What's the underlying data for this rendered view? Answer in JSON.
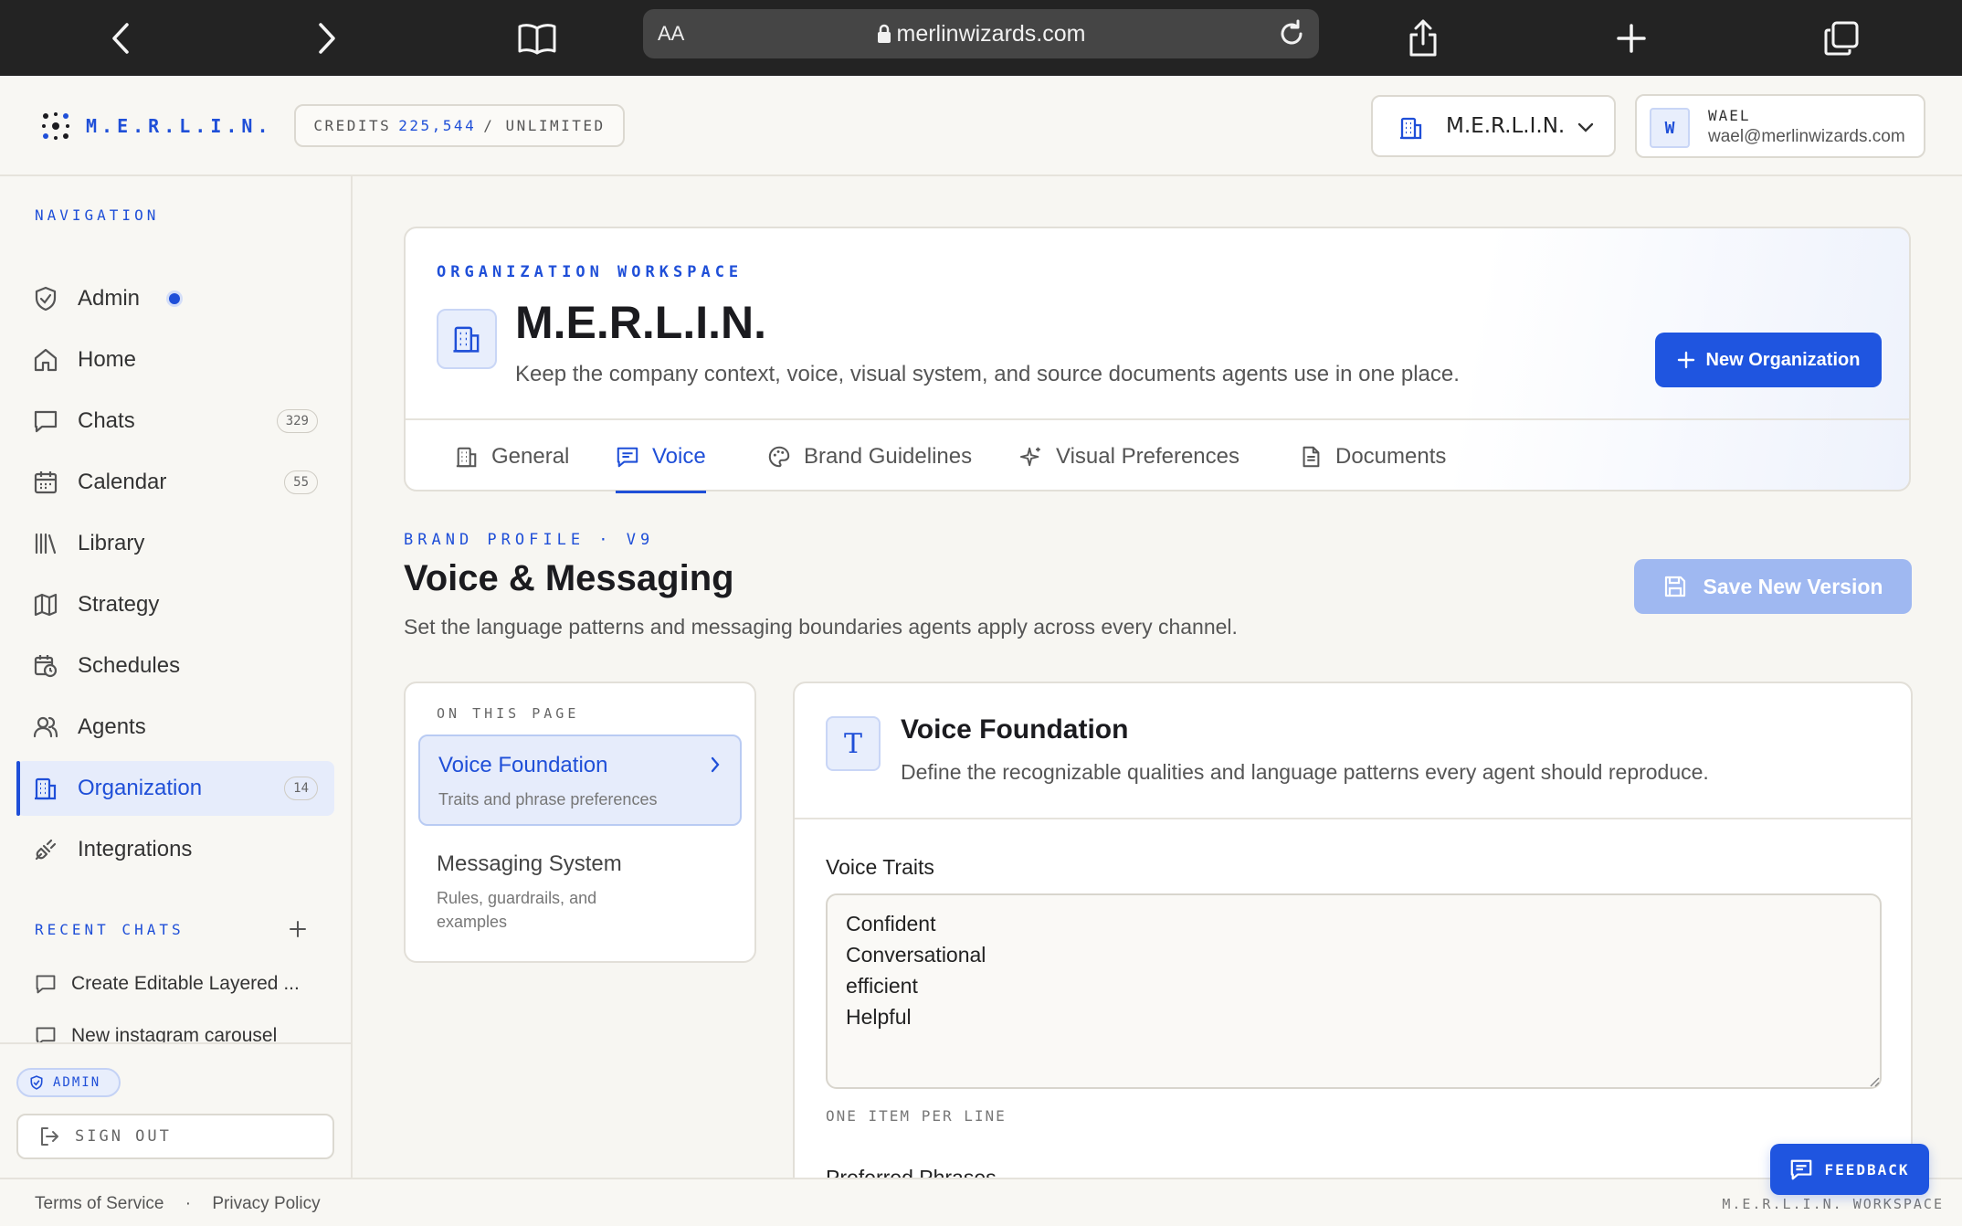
{
  "browser": {
    "aa_label": "AA",
    "url": "merlinwizards.com"
  },
  "header": {
    "logo_text": "M.E.R.L.I.N.",
    "credits_label": "CREDITS",
    "credits_value": "225,544",
    "credits_suffix": "/ UNLIMITED",
    "org_selector": "M.E.R.L.I.N.",
    "user_initial": "W",
    "user_name": "WAEL",
    "user_email": "wael@merlinwizards.com"
  },
  "sidebar": {
    "nav_label": "NAVIGATION",
    "items": [
      {
        "label": "Admin",
        "icon": "shield-icon"
      },
      {
        "label": "Home",
        "icon": "home-icon"
      },
      {
        "label": "Chats",
        "icon": "chat-icon",
        "badge": "329"
      },
      {
        "label": "Calendar",
        "icon": "calendar-icon",
        "badge": "55"
      },
      {
        "label": "Library",
        "icon": "library-icon"
      },
      {
        "label": "Strategy",
        "icon": "map-icon"
      },
      {
        "label": "Schedules",
        "icon": "schedule-icon"
      },
      {
        "label": "Agents",
        "icon": "users-icon"
      },
      {
        "label": "Organization",
        "icon": "building-icon",
        "badge": "14",
        "active": true
      },
      {
        "label": "Integrations",
        "icon": "plug-icon"
      }
    ],
    "recent_label": "RECENT CHATS",
    "recent_chats": [
      "Create Editable Layered ...",
      "New instagram carousel"
    ],
    "admin_badge": "ADMIN",
    "sign_out": "SIGN OUT"
  },
  "org_card": {
    "eyebrow": "ORGANIZATION WORKSPACE",
    "title": "M.E.R.L.I.N.",
    "description": "Keep the company context, voice, visual system, and source documents agents use in one place.",
    "new_org_button": "New Organization",
    "tabs": [
      {
        "label": "General",
        "icon": "building-icon"
      },
      {
        "label": "Voice",
        "icon": "message-icon",
        "active": true
      },
      {
        "label": "Brand Guidelines",
        "icon": "palette-icon"
      },
      {
        "label": "Visual Preferences",
        "icon": "sparkle-icon"
      },
      {
        "label": "Documents",
        "icon": "document-icon"
      }
    ]
  },
  "brand_profile": {
    "eyebrow": "BRAND PROFILE · V9",
    "title": "Voice & Messaging",
    "description": "Set the language patterns and messaging boundaries agents apply across every channel.",
    "save_button": "Save New Version"
  },
  "toc": {
    "label": "ON THIS PAGE",
    "items": [
      {
        "title": "Voice Foundation",
        "subtitle": "Traits and phrase preferences",
        "active": true
      },
      {
        "title": "Messaging System",
        "subtitle": "Rules, guardrails, and examples"
      }
    ]
  },
  "voice_foundation": {
    "icon_letter": "T",
    "title": "Voice Foundation",
    "description": "Define the recognizable qualities and language patterns every agent should reproduce.",
    "traits_label": "Voice Traits",
    "traits_value": "Confident\nConversational\nefficient\nHelpful",
    "traits_hint": "ONE ITEM PER LINE",
    "next_label": "Preferred Phrases"
  },
  "footer": {
    "terms": "Terms of Service",
    "separator": "·",
    "privacy": "Privacy Policy",
    "workspace": "M.E.R.L.I.N. WORKSPACE"
  },
  "feedback_button": "FEEDBACK",
  "colors": {
    "accent": "#1f55e0",
    "accent_light": "#e6ecfb",
    "background": "#f7f6f2",
    "browser_chrome": "#232323"
  }
}
